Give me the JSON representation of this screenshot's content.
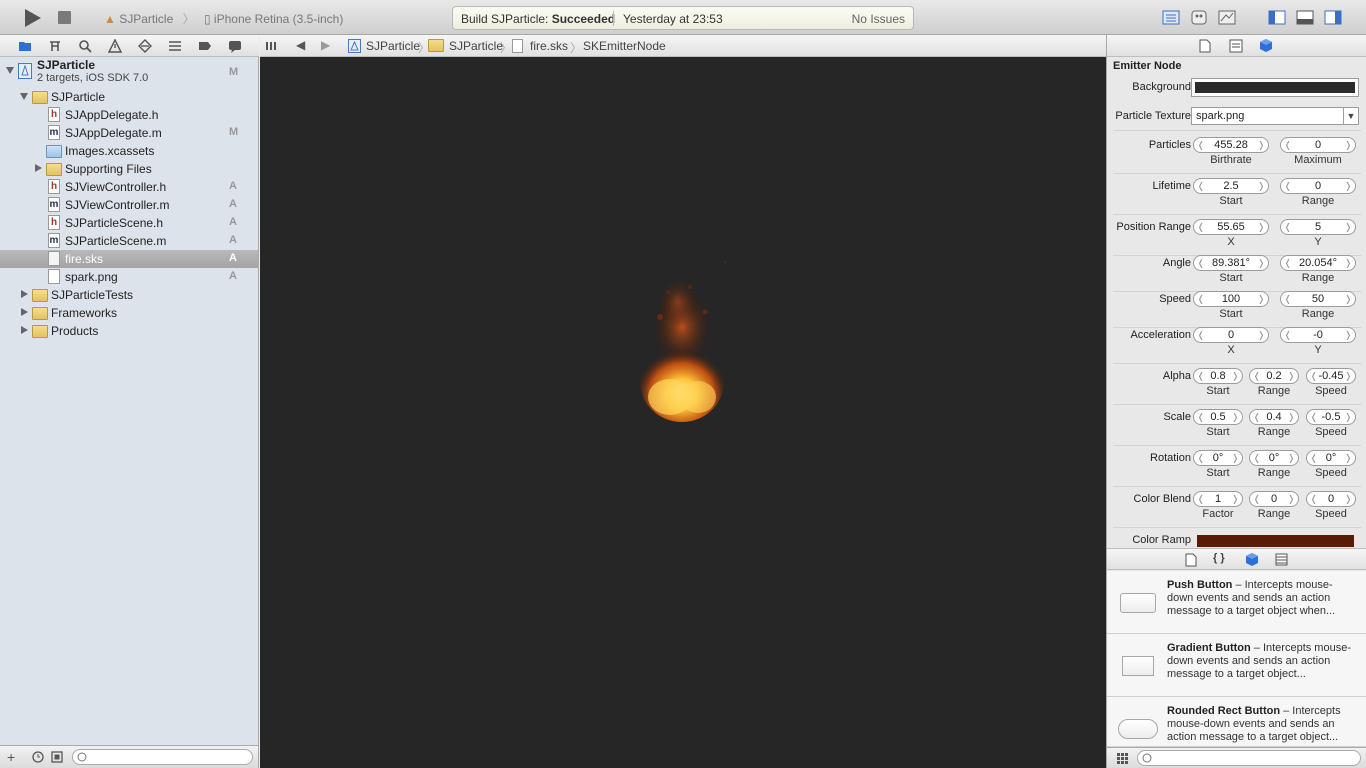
{
  "toolbar": {
    "scheme": "SJParticle",
    "device": "iPhone Retina (3.5-inch)",
    "status_prefix": "Build SJParticle: ",
    "status_result": "Succeeded",
    "status_time": "Yesterday at 23:53",
    "status_issues": "No Issues"
  },
  "jumpbar": {
    "crumbs": [
      "SJParticle",
      "SJParticle",
      "fire.sks",
      "SKEmitterNode"
    ]
  },
  "navigator": {
    "project_name": "SJParticle",
    "project_sub": "2 targets, iOS SDK 7.0",
    "project_status": "M",
    "items": [
      {
        "label": "SJParticle",
        "status": ""
      },
      {
        "label": "SJAppDelegate.h",
        "status": ""
      },
      {
        "label": "SJAppDelegate.m",
        "status": "M"
      },
      {
        "label": "Images.xcassets",
        "status": ""
      },
      {
        "label": "Supporting Files",
        "status": ""
      },
      {
        "label": "SJViewController.h",
        "status": "A"
      },
      {
        "label": "SJViewController.m",
        "status": "A"
      },
      {
        "label": "SJParticleScene.h",
        "status": "A"
      },
      {
        "label": "SJParticleScene.m",
        "status": "A"
      },
      {
        "label": "fire.sks",
        "status": "A"
      },
      {
        "label": "spark.png",
        "status": "A"
      },
      {
        "label": "SJParticleTests",
        "status": ""
      },
      {
        "label": "Frameworks",
        "status": ""
      },
      {
        "label": "Products",
        "status": ""
      }
    ]
  },
  "inspector": {
    "section_title": "Emitter Node",
    "background_label": "Background",
    "texture_label": "Particle Texture",
    "texture_value": "spark.png",
    "rows": [
      {
        "label": "Particles",
        "fields": [
          "455.28",
          "0"
        ],
        "subs": [
          "Birthrate",
          "Maximum"
        ]
      },
      {
        "label": "Lifetime",
        "fields": [
          "2.5",
          "0"
        ],
        "subs": [
          "Start",
          "Range"
        ]
      },
      {
        "label": "Position Range",
        "fields": [
          "55.65",
          "5"
        ],
        "subs": [
          "X",
          "Y"
        ]
      },
      {
        "label": "Angle",
        "fields": [
          "89.381°",
          "20.054°"
        ],
        "subs": [
          "Start",
          "Range"
        ]
      },
      {
        "label": "Speed",
        "fields": [
          "100",
          "50"
        ],
        "subs": [
          "Start",
          "Range"
        ]
      },
      {
        "label": "Acceleration",
        "fields": [
          "0",
          "-0"
        ],
        "subs": [
          "X",
          "Y"
        ]
      },
      {
        "label": "Alpha",
        "fields": [
          "0.8",
          "0.2",
          "-0.45"
        ],
        "subs": [
          "Start",
          "Range",
          "Speed"
        ]
      },
      {
        "label": "Scale",
        "fields": [
          "0.5",
          "0.4",
          "-0.5"
        ],
        "subs": [
          "Start",
          "Range",
          "Speed"
        ]
      },
      {
        "label": "Rotation",
        "fields": [
          "0°",
          "0°",
          "0°"
        ],
        "subs": [
          "Start",
          "Range",
          "Speed"
        ]
      },
      {
        "label": "Color Blend",
        "fields": [
          "1",
          "0",
          "0"
        ],
        "subs": [
          "Factor",
          "Range",
          "Speed"
        ]
      }
    ],
    "color_ramp_label": "Color Ramp",
    "color_ramp_color": "#5a1a05"
  },
  "library": {
    "items": [
      {
        "name": "Push Button",
        "desc": " – Intercepts mouse-down events and sends an action message to a target object when..."
      },
      {
        "name": "Gradient Button",
        "desc": " – Intercepts mouse-down events and sends an action message to a target object..."
      },
      {
        "name": "Rounded Rect Button",
        "desc": " – Intercepts mouse-down events and sends an action message to a target object..."
      }
    ]
  }
}
